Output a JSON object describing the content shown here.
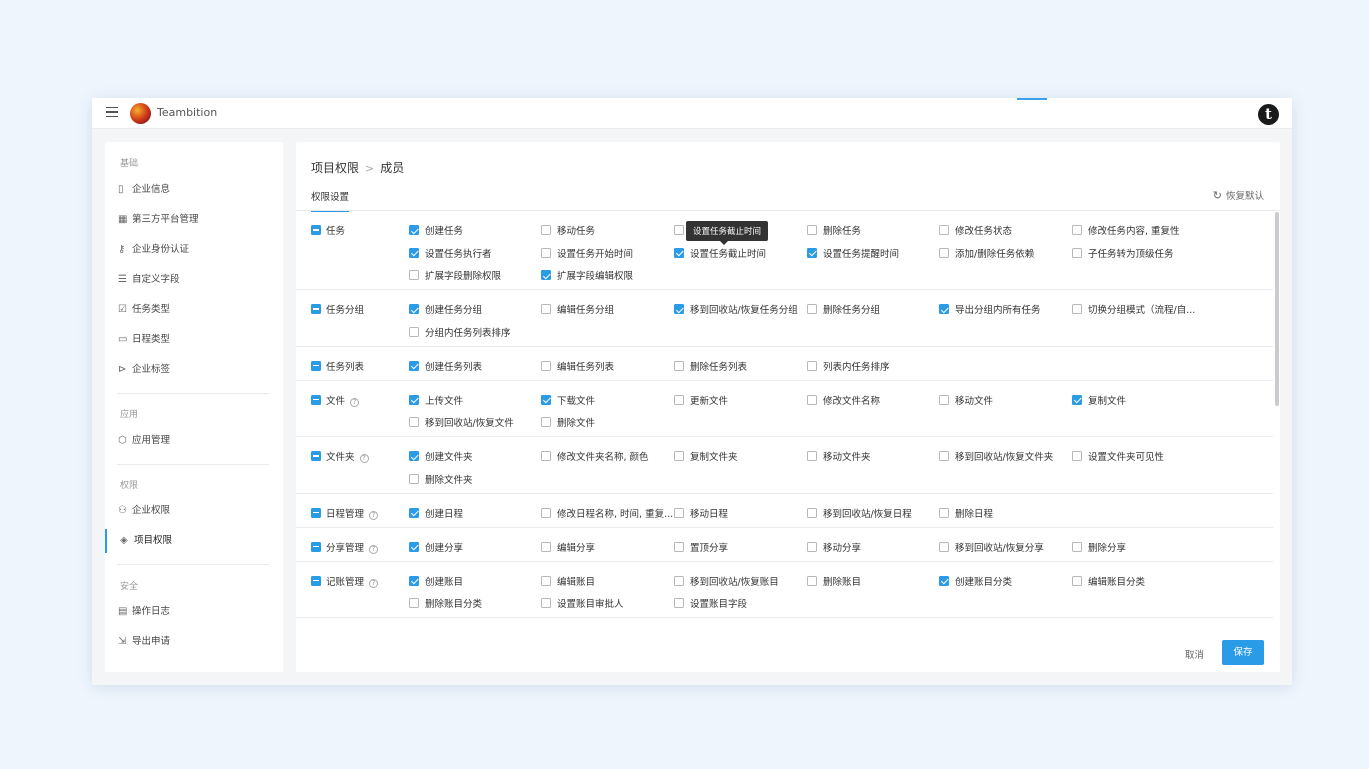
{
  "app": {
    "title": "Teambition",
    "avatar_letter": "t"
  },
  "sidebar": {
    "sections": [
      {
        "title": "基础",
        "items": [
          {
            "label": "企业信息",
            "icon": "building-icon"
          },
          {
            "label": "第三方平台管理",
            "icon": "grid-icon"
          },
          {
            "label": "企业身份认证",
            "icon": "key-icon"
          },
          {
            "label": "自定义字段",
            "icon": "fields-icon"
          },
          {
            "label": "任务类型",
            "icon": "checkbox-icon"
          },
          {
            "label": "日程类型",
            "icon": "calendar-icon"
          },
          {
            "label": "企业标签",
            "icon": "tag-icon"
          }
        ]
      },
      {
        "title": "应用",
        "items": [
          {
            "label": "应用管理",
            "icon": "cube-icon"
          }
        ]
      },
      {
        "title": "权限",
        "items": [
          {
            "label": "企业权限",
            "icon": "users-icon"
          },
          {
            "label": "项目权限",
            "icon": "layers-icon",
            "active": true
          }
        ]
      },
      {
        "title": "安全",
        "items": [
          {
            "label": "操作日志",
            "icon": "log-icon"
          },
          {
            "label": "导出申请",
            "icon": "export-icon"
          }
        ]
      }
    ]
  },
  "main": {
    "breadcrumb": {
      "root": "项目权限",
      "sep": ">",
      "current": "成员"
    },
    "tab": "权限设置",
    "restore_label": "恢复默认",
    "tooltip": "设置任务截止时间",
    "groups": [
      {
        "name": "任务",
        "help": false,
        "perms": [
          {
            "label": "创建任务",
            "checked": true
          },
          {
            "label": "移动任务",
            "checked": false
          },
          {
            "label": "复制任务",
            "checked": false
          },
          {
            "label": "删除任务",
            "checked": false
          },
          {
            "label": "修改任务状态",
            "checked": false
          },
          {
            "label": "修改任务内容, 重复性",
            "checked": false
          },
          {
            "label": "设置任务执行者",
            "checked": true
          },
          {
            "label": "设置任务开始时间",
            "checked": false
          },
          {
            "label": "设置任务截止时间",
            "checked": true
          },
          {
            "label": "设置任务提醒时间",
            "checked": true
          },
          {
            "label": "添加/删除任务依赖",
            "checked": false
          },
          {
            "label": "子任务转为顶级任务",
            "checked": false
          },
          {
            "label": "扩展字段删除权限",
            "checked": false
          },
          {
            "label": "扩展字段编辑权限",
            "checked": true
          }
        ]
      },
      {
        "name": "任务分组",
        "help": false,
        "perms": [
          {
            "label": "创建任务分组",
            "checked": true
          },
          {
            "label": "编辑任务分组",
            "checked": false
          },
          {
            "label": "移到回收站/恢复任务分组",
            "checked": true
          },
          {
            "label": "删除任务分组",
            "checked": false
          },
          {
            "label": "导出分组内所有任务",
            "checked": true
          },
          {
            "label": "切换分组模式（流程/自...",
            "checked": false
          },
          {
            "label": "分组内任务列表排序",
            "checked": false
          }
        ]
      },
      {
        "name": "任务列表",
        "help": false,
        "perms": [
          {
            "label": "创建任务列表",
            "checked": true
          },
          {
            "label": "编辑任务列表",
            "checked": false
          },
          {
            "label": "删除任务列表",
            "checked": false
          },
          {
            "label": "列表内任务排序",
            "checked": false
          }
        ]
      },
      {
        "name": "文件",
        "help": true,
        "perms": [
          {
            "label": "上传文件",
            "checked": true
          },
          {
            "label": "下载文件",
            "checked": true
          },
          {
            "label": "更新文件",
            "checked": false
          },
          {
            "label": "修改文件名称",
            "checked": false
          },
          {
            "label": "移动文件",
            "checked": false
          },
          {
            "label": "复制文件",
            "checked": true
          },
          {
            "label": "移到回收站/恢复文件",
            "checked": false
          },
          {
            "label": "删除文件",
            "checked": false
          }
        ]
      },
      {
        "name": "文件夹",
        "help": true,
        "perms": [
          {
            "label": "创建文件夹",
            "checked": true
          },
          {
            "label": "修改文件夹名称, 颜色",
            "checked": false
          },
          {
            "label": "复制文件夹",
            "checked": false
          },
          {
            "label": "移动文件夹",
            "checked": false
          },
          {
            "label": "移到回收站/恢复文件夹",
            "checked": false
          },
          {
            "label": "设置文件夹可见性",
            "checked": false
          },
          {
            "label": "删除文件夹",
            "checked": false
          }
        ]
      },
      {
        "name": "日程管理",
        "help": true,
        "perms": [
          {
            "label": "创建日程",
            "checked": true
          },
          {
            "label": "修改日程名称, 时间, 重复...",
            "checked": false
          },
          {
            "label": "移动日程",
            "checked": false
          },
          {
            "label": "移到回收站/恢复日程",
            "checked": false
          },
          {
            "label": "删除日程",
            "checked": false
          }
        ]
      },
      {
        "name": "分享管理",
        "help": true,
        "perms": [
          {
            "label": "创建分享",
            "checked": true
          },
          {
            "label": "编辑分享",
            "checked": false
          },
          {
            "label": "置顶分享",
            "checked": false
          },
          {
            "label": "移动分享",
            "checked": false
          },
          {
            "label": "移到回收站/恢复分享",
            "checked": false
          },
          {
            "label": "删除分享",
            "checked": false
          }
        ]
      },
      {
        "name": "记账管理",
        "help": true,
        "perms": [
          {
            "label": "创建账目",
            "checked": true
          },
          {
            "label": "编辑账目",
            "checked": false
          },
          {
            "label": "移到回收站/恢复账目",
            "checked": false
          },
          {
            "label": "删除账目",
            "checked": false
          },
          {
            "label": "创建账目分类",
            "checked": true
          },
          {
            "label": "编辑账目分类",
            "checked": false
          },
          {
            "label": "删除账目分类",
            "checked": false
          },
          {
            "label": "设置账目审批人",
            "checked": false
          },
          {
            "label": "设置账目字段",
            "checked": false
          }
        ]
      }
    ],
    "footer": {
      "cancel": "取消",
      "save": "保存"
    }
  }
}
